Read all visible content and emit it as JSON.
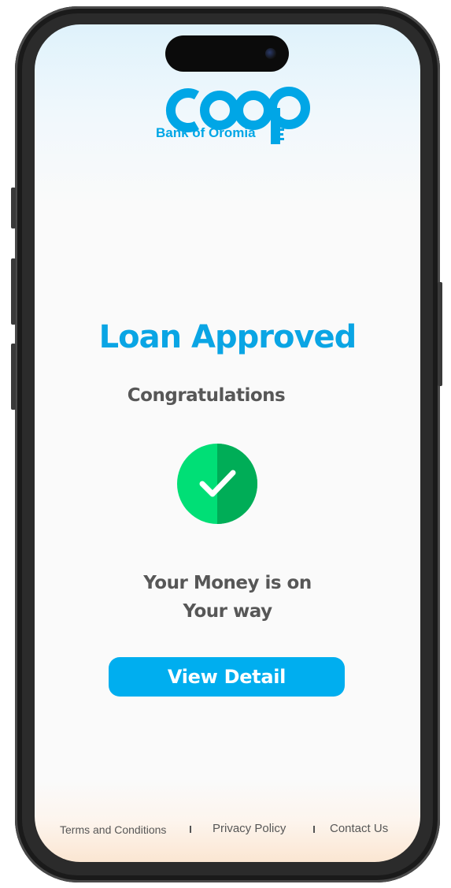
{
  "brand": {
    "logo_text": "coop",
    "subtitle": "Bank of Oromia",
    "color": "#00a6e6"
  },
  "main": {
    "title": "Loan Approved",
    "subtitle": "Congratulations",
    "status_icon": "check-circle-icon",
    "message_line1": "Your Money is on",
    "message_line2": "Your way",
    "cta_label": "View Detail"
  },
  "footer": {
    "terms": "Terms and Conditions",
    "privacy": "Privacy Policy",
    "contact": "Contact Us"
  },
  "colors": {
    "accent": "#00aeef",
    "title": "#0aa5e4",
    "text": "#575757",
    "success_light": "#00df76",
    "success_dark": "#00ad57"
  }
}
